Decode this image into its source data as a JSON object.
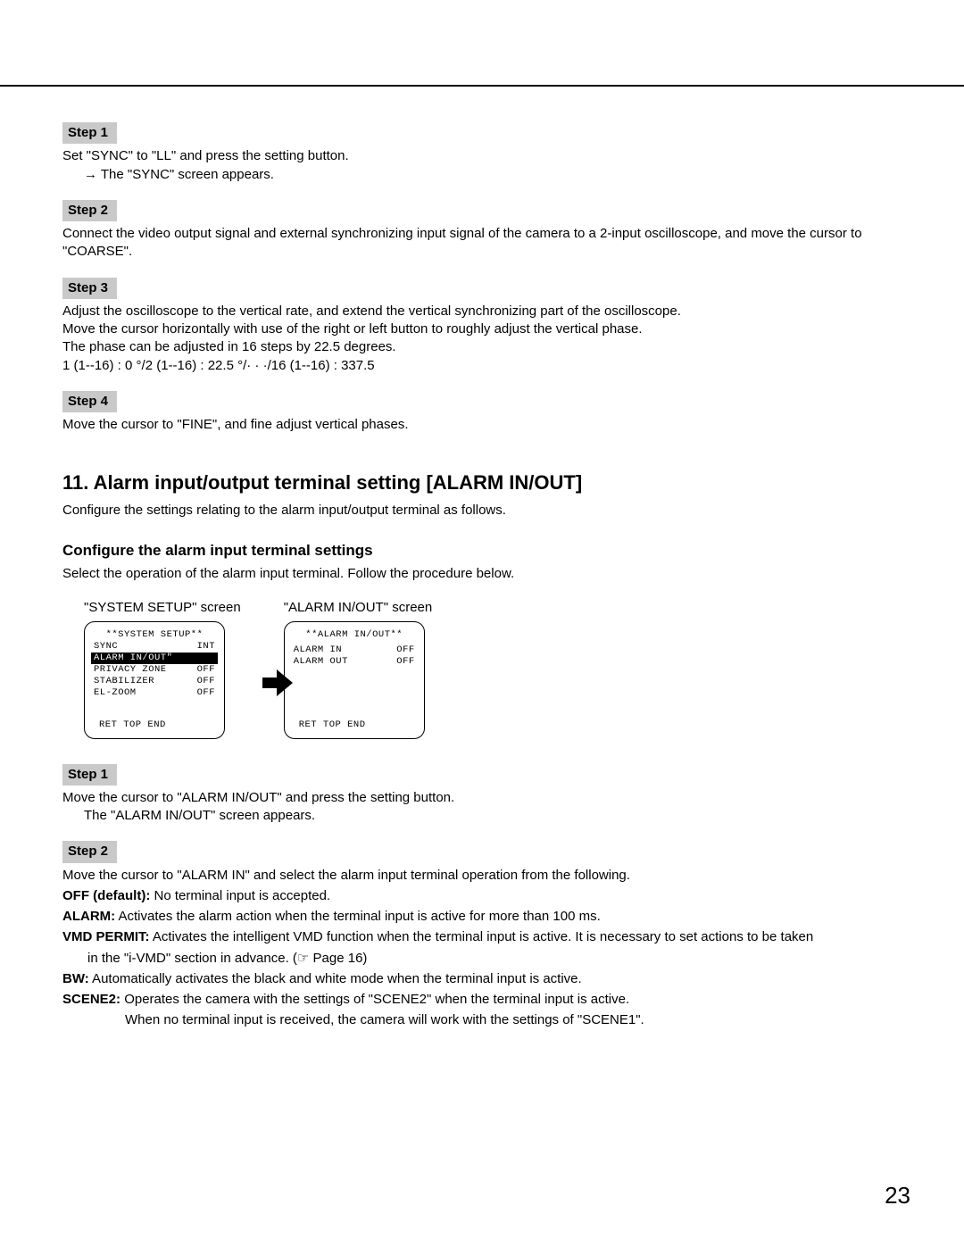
{
  "steps_top": {
    "s1": {
      "label": "Step 1",
      "line1": "Set \"SYNC\" to \"LL\" and press the setting button.",
      "line2": "→ The \"SYNC\" screen appears."
    },
    "s2": {
      "label": "Step 2",
      "line1": "Connect the video output signal and external synchronizing input signal of the camera to a 2-input oscilloscope, and move the cursor to \"COARSE\"."
    },
    "s3": {
      "label": "Step 3",
      "line1": "Adjust the oscilloscope to the vertical rate, and extend the vertical synchronizing part of the oscilloscope.",
      "line2": "Move the cursor horizontally with use of the right or left button to roughly adjust the vertical phase.",
      "line3": "The phase can be adjusted in 16 steps by 22.5 degrees.",
      "line4": "1 (1--16) : 0 °/2 (1--16) : 22.5 °/· · ·/16 (1--16) : 337.5"
    },
    "s4": {
      "label": "Step 4",
      "line1": "Move the cursor to \"FINE\", and fine adjust vertical phases."
    }
  },
  "section": {
    "title": "11. Alarm input/output terminal setting [ALARM IN/OUT]",
    "intro": "Configure the settings relating to the alarm input/output terminal as follows."
  },
  "subsection": {
    "title": "Configure the alarm input terminal settings",
    "intro": "Select the operation of the alarm input terminal. Follow the procedure below."
  },
  "screens": {
    "left": {
      "caption": "\"SYSTEM SETUP\" screen",
      "title": "**SYSTEM SETUP**",
      "rows": [
        {
          "lbl": "SYNC",
          "val": "INT"
        },
        {
          "lbl": "ALARM IN/OUT\"",
          "val": "",
          "highlight": true
        },
        {
          "lbl": "PRIVACY ZONE",
          "val": "OFF"
        },
        {
          "lbl": "STABILIZER",
          "val": "OFF"
        },
        {
          "lbl": "EL-ZOOM",
          "val": "OFF"
        }
      ],
      "footer": "RET TOP END"
    },
    "right": {
      "caption": "\"ALARM IN/OUT\" screen",
      "title": "**ALARM IN/OUT**",
      "rows": [
        {
          "lbl": "ALARM IN",
          "val": "OFF"
        },
        {
          "lbl": "ALARM OUT",
          "val": "OFF"
        }
      ],
      "footer": "RET TOP END"
    }
  },
  "steps_bottom": {
    "s1": {
      "label": "Step 1",
      "line1": "Move the cursor to \"ALARM IN/OUT\" and press the setting button.",
      "line2": "The \"ALARM IN/OUT\" screen appears."
    },
    "s2": {
      "label": "Step 2",
      "line1": "Move the cursor to \"ALARM IN\" and select the alarm input terminal operation from the following.",
      "def_off_label": "OFF (default):",
      "def_off_text": " No terminal input is accepted.",
      "def_alarm_label": "ALARM:",
      "def_alarm_text": " Activates the alarm action when the terminal input is active for more than 100 ms.",
      "def_vmd_label": "VMD PERMIT:",
      "def_vmd_text": " Activates the intelligent VMD function when the terminal input is active. It is necessary to set actions to be taken",
      "def_vmd_text2": "in the \"i-VMD\" section in advance. (☞ Page 16)",
      "def_bw_label": "BW:",
      "def_bw_text": " Automatically activates the black and white mode when the terminal input is active.",
      "def_scene_label": "SCENE2:",
      "def_scene_text": " Operates the camera with the settings of \"SCENE2\" when the terminal input is active.",
      "def_scene_text2": "When no terminal input is received, the camera will work with the settings of \"SCENE1\"."
    }
  },
  "page_number": "23"
}
